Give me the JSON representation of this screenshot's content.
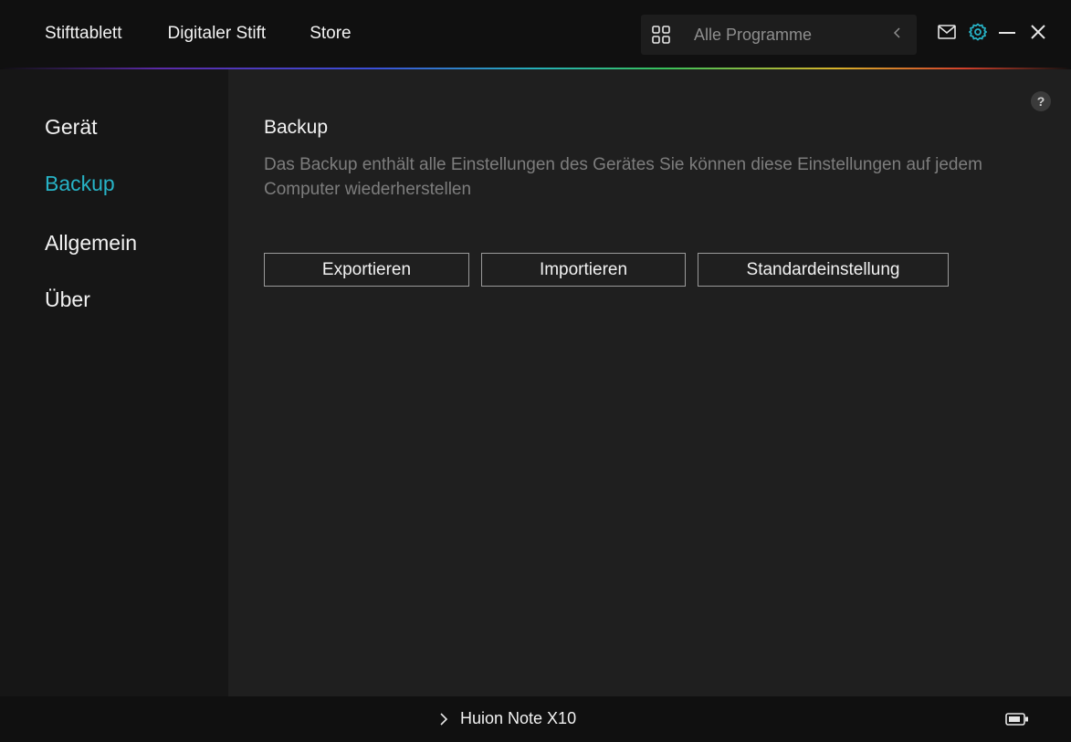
{
  "topbar": {
    "nav": [
      "Stifttablett",
      "Digitaler Stift",
      "Store"
    ],
    "program_select": {
      "label": "Alle Programme",
      "icon": "grid-icon"
    },
    "controls": [
      "mail-icon",
      "gear-icon",
      "minimize-icon",
      "close-icon"
    ]
  },
  "sidebar": {
    "items": [
      {
        "label": "Gerät"
      },
      {
        "label": "Backup"
      },
      {
        "label": "Allgemein"
      },
      {
        "label": "Über"
      }
    ],
    "active_index": 1
  },
  "main": {
    "title": "Backup",
    "description": "Das Backup enthält alle Einstellungen des Gerätes Sie können diese Einstellungen auf jedem Computer wiederherstellen",
    "buttons": {
      "export": "Exportieren",
      "import": "Importieren",
      "default": "Standardeinstellung"
    },
    "help": "?"
  },
  "footer": {
    "device_name": "Huion Note X10"
  },
  "colors": {
    "accent": "#27b3c6",
    "background": "#1f1f1f",
    "sidebar": "#161616",
    "topbar": "#101010"
  }
}
